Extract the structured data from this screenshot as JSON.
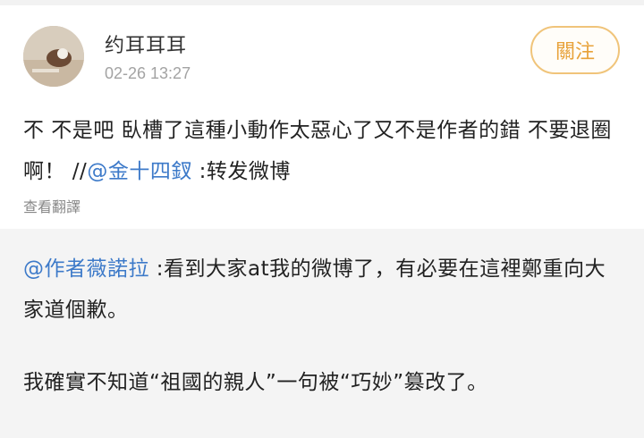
{
  "post": {
    "username": "约耳耳耳",
    "timestamp": "02-26 13:27",
    "follow_label": "關注",
    "text_main": "不 不是吧 臥槽了這種小動作太惡心了又不是作者的錯 不要退圈啊！ //",
    "mention": "@金十四釵",
    "text_tail": " :转发微博",
    "translate_label": "查看翻譯"
  },
  "repost": {
    "mention": "@作者薇諾拉",
    "text_main": " :看到大家at我的微博了，有必要在這裡鄭重向大家道個歉。",
    "text_second": "我確實不知道“祖國的親人”一句被“巧妙”篡改了。"
  },
  "colors": {
    "mention": "#3d7ac9",
    "follow_accent": "#e8a23a",
    "repost_bg": "#f4f4f4"
  }
}
